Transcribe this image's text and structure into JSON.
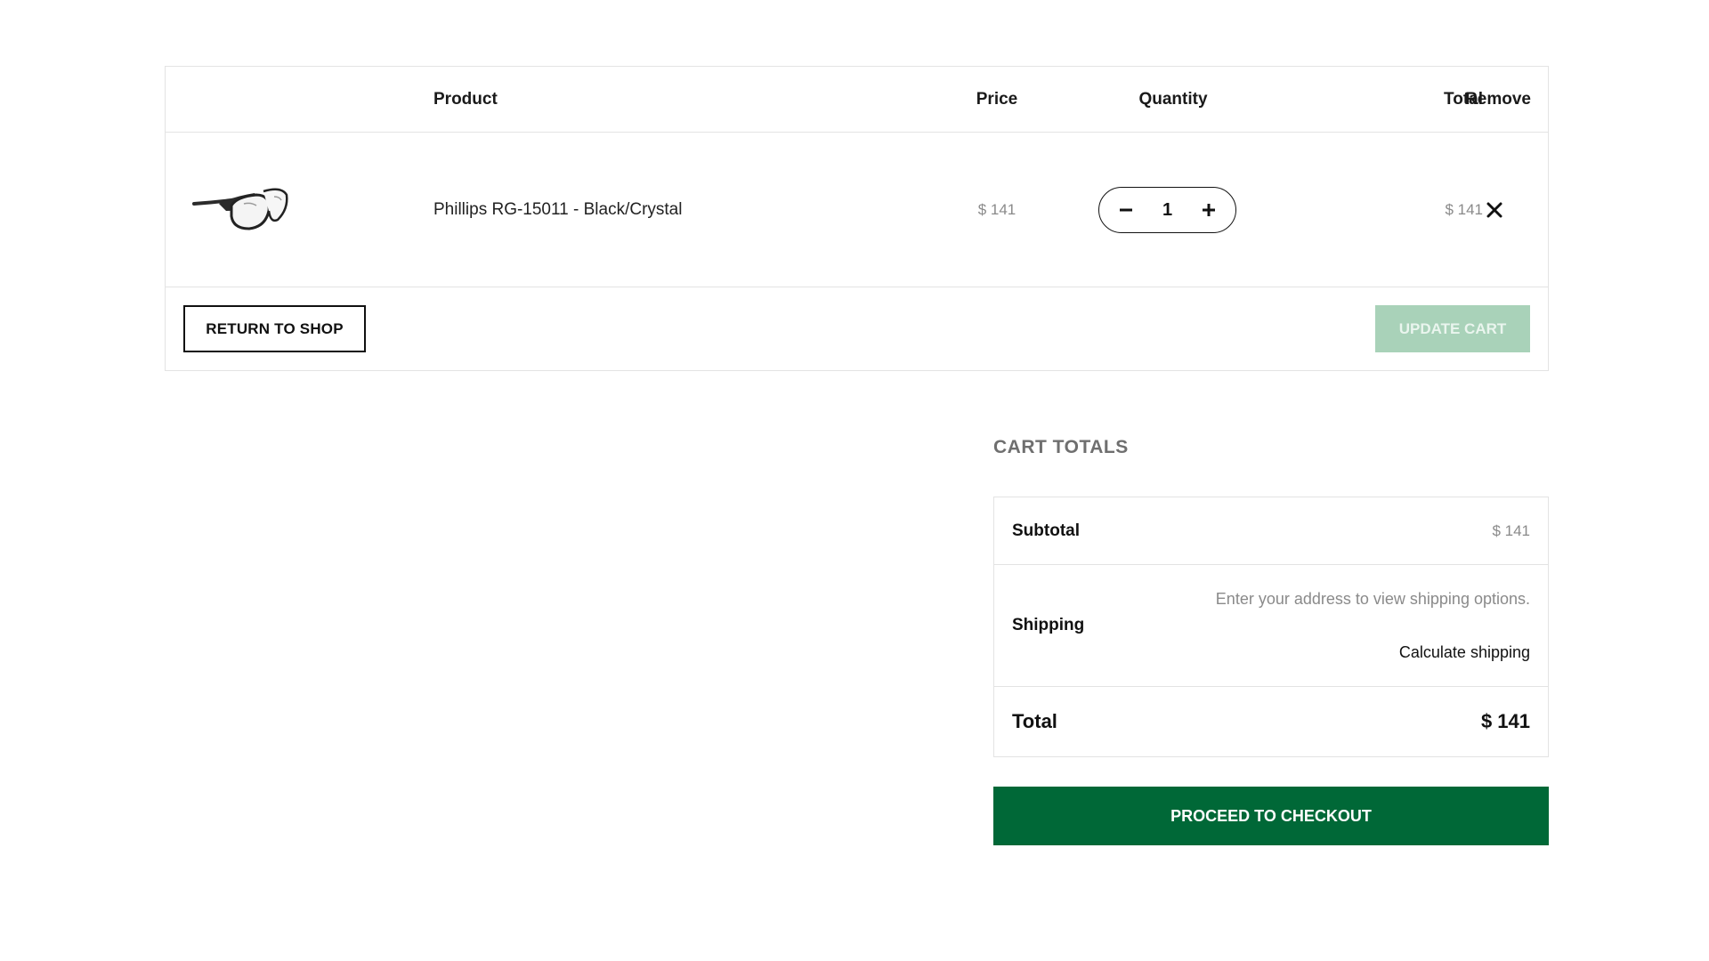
{
  "cart": {
    "headers": {
      "product": "Product",
      "price": "Price",
      "quantity": "Quantity",
      "total": "Total",
      "remove": "Remove"
    },
    "items": [
      {
        "name": "Phillips RG-15011 - Black/Crystal",
        "price": "$ 141",
        "quantity": "1",
        "total": "$ 141",
        "thumbnail_icon": "safety-glasses-icon"
      }
    ],
    "actions": {
      "return_label": "RETURN TO SHOP",
      "update_label": "UPDATE CART"
    }
  },
  "totals": {
    "title": "CART TOTALS",
    "subtotal_label": "Subtotal",
    "subtotal_value": "$ 141",
    "shipping_label": "Shipping",
    "shipping_info": "Enter your address to view shipping options.",
    "calculate_shipping_label": "Calculate shipping",
    "total_label": "Total",
    "total_value": "$ 141",
    "checkout_label": "PROCEED TO CHECKOUT"
  },
  "colors": {
    "brand_green": "#006837",
    "update_button_disabled": "#a9d2b9",
    "muted_text": "#8a8a8a",
    "border": "#e3e3e3"
  }
}
